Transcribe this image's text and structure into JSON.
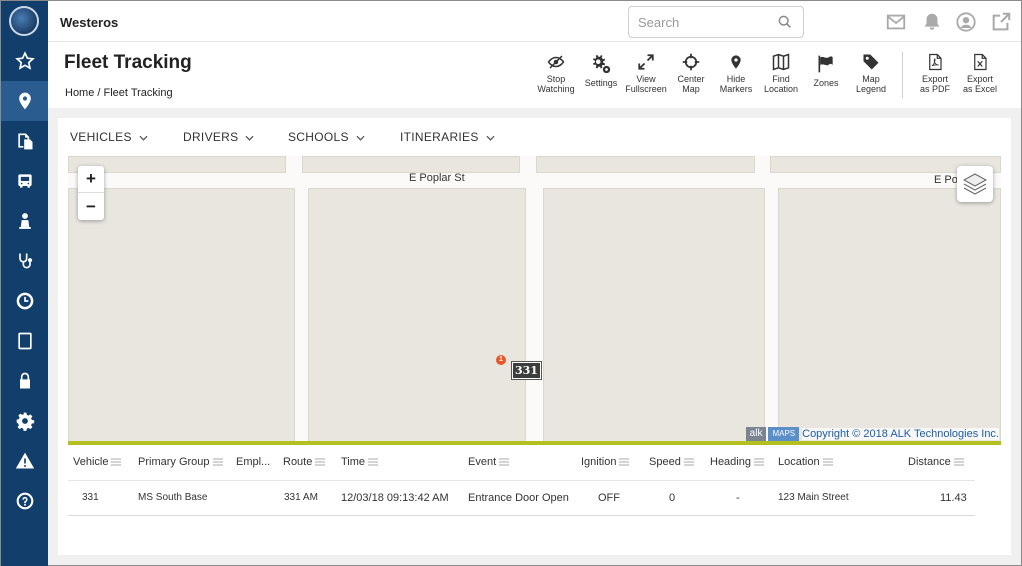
{
  "app": {
    "name": "Westeros"
  },
  "search": {
    "placeholder": "Search"
  },
  "sidebar": {
    "items": [
      {
        "icon": "star-icon"
      },
      {
        "icon": "map-marker-icon",
        "active": true
      },
      {
        "icon": "documents-icon"
      },
      {
        "icon": "bus-icon"
      },
      {
        "icon": "person-icon"
      },
      {
        "icon": "stethoscope-icon"
      },
      {
        "icon": "clock-icon"
      },
      {
        "icon": "tablet-icon"
      },
      {
        "icon": "lock-icon"
      },
      {
        "icon": "gear-icon"
      },
      {
        "icon": "warning-icon"
      },
      {
        "icon": "help-icon"
      }
    ]
  },
  "header": {
    "title": "Fleet Tracking",
    "breadcrumb": "Home / Fleet Tracking"
  },
  "toolbar": [
    {
      "label": "Stop Watching",
      "line1": "Stop",
      "line2": "Watching",
      "icon": "eye-slash-icon"
    },
    {
      "label": "Settings",
      "line1": "Settings",
      "line2": "",
      "icon": "gears-icon"
    },
    {
      "label": "View Fullscreen",
      "line1": "View",
      "line2": "Fullscreen",
      "icon": "expand-icon"
    },
    {
      "label": "Center Map",
      "line1": "Center",
      "line2": "Map",
      "icon": "crosshairs-icon"
    },
    {
      "label": "Hide Markers",
      "line1": "Hide",
      "line2": "Markers",
      "icon": "map-pin-icon"
    },
    {
      "label": "Find Location",
      "line1": "Find",
      "line2": "Location",
      "icon": "map-icon"
    },
    {
      "label": "Zones",
      "line1": "Zones",
      "line2": "",
      "icon": "flag-icon"
    },
    {
      "label": "Map Legend",
      "line1": "Map",
      "line2": "Legend",
      "icon": "tag-icon"
    },
    {
      "label": "Export as PDF",
      "line1": "Export",
      "line2": "as PDF",
      "icon": "pdf-file-icon"
    },
    {
      "label": "Export as Excel",
      "line1": "Export",
      "line2": "as Excel",
      "icon": "excel-file-icon"
    }
  ],
  "tabs": [
    "VEHICLES",
    "DRIVERS",
    "SCHOOLS",
    "ITINERARIES"
  ],
  "map": {
    "street_main": "E Poplar St",
    "street_right": "E Po",
    "zoom_in": "+",
    "zoom_out": "−",
    "marker_badge": "1",
    "vehicle_label": "331",
    "attribution": {
      "alk": "alk",
      "maps": "MAPS",
      "copyright": "Copyright © 2018 ALK Technologies Inc."
    },
    "accent_color": "#b4bf22"
  },
  "grid": {
    "columns": [
      "Vehicle",
      "Primary Group",
      "Empl...",
      "Route",
      "Time",
      "Event",
      "Ignition",
      "Speed",
      "Heading",
      "Location",
      "Distance"
    ],
    "rows": [
      {
        "vehicle": "331",
        "primary_group": "MS South Base",
        "employee": "",
        "route": "331 AM",
        "time": "12/03/18 09:13:42 AM",
        "event": "Entrance Door Open",
        "ignition": "OFF",
        "speed": "0",
        "heading": "-",
        "location": "123 Main Street",
        "distance": "11.43"
      }
    ]
  },
  "colors": {
    "sidebar": "#123e6b",
    "sidebar_active": "#2a5c8f"
  }
}
